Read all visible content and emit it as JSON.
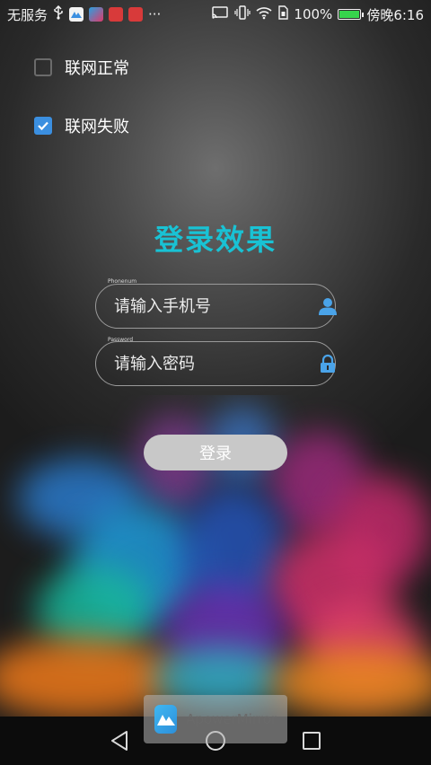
{
  "status_bar": {
    "carrier": "无服务",
    "battery_percent": "100%",
    "time": "傍晚6:16",
    "more": "···",
    "battery_level": 1.0
  },
  "options": [
    {
      "label": "联网正常",
      "checked": false
    },
    {
      "label": "联网失败",
      "checked": true
    }
  ],
  "title": "登录效果",
  "phone_field": {
    "caption": "Phonenum",
    "placeholder": "请输入手机号"
  },
  "password_field": {
    "caption": "Password",
    "placeholder": "请输入密码"
  },
  "login_button": "登录",
  "watermark": {
    "text": "ApowerMirror"
  },
  "colors": {
    "title": "#19c2d4",
    "checkbox_checked": "#3b8fe0",
    "icon_blue": "#4aa3e8"
  }
}
